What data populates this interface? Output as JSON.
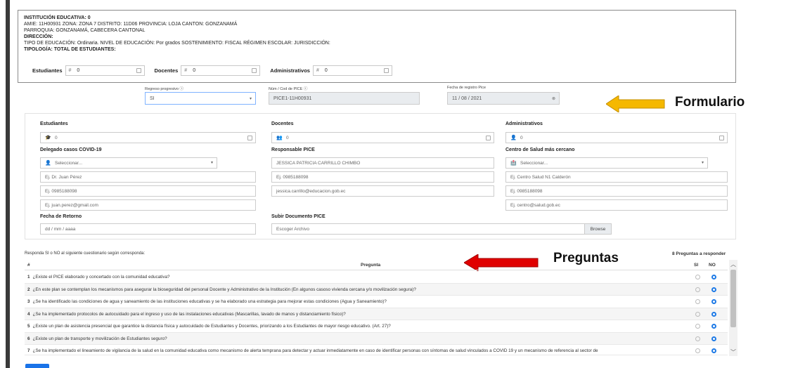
{
  "institution": {
    "line1": "INSTITUCIÓN EDUCATIVA: 0",
    "line2": "AMIE: 11H00931 ZONA: ZONA 7  DISTRITO: 11D06  PROVINCIA: LOJA  CANTON: GONZANAMÁ",
    "line3": "PARROQUIA: GONZANAMÁ, CABECERA CANTONAL",
    "line4": "DIRECCIÓN:",
    "line5": "TIPO DE EDUCACIÓN: Ordinaria.  NIVEL DE EDUCACIÓN: Por grados  SOSTENIMIENTO: FISCAL  RÉGIMEN ESCOLAR:   JURISDICCIÓN:",
    "line6": "TIPOLOGÍA:  TOTAL DE ESTUDIANTES:",
    "counters": [
      {
        "label": "Estudiantes",
        "hash": "#",
        "value": "0"
      },
      {
        "label": "Docentes",
        "hash": "#",
        "value": "0"
      },
      {
        "label": "Administrativos",
        "hash": "#",
        "value": "0"
      }
    ]
  },
  "header_form": {
    "regreso_label": "Regreso progresivo ⓘ",
    "regreso_value": "SI",
    "cod_label": "Núm / Cod de PICE ⓘ",
    "cod_value": "PICE1-11H00931",
    "fecha_label": "Fecha de registro Pice",
    "fecha_value": "11 / 08 / 2021"
  },
  "annotations": {
    "formulario": "Formulario",
    "preguntas": "Preguntas",
    "arrow_yellow_color": "#f5b800",
    "arrow_red_color": "#e00000"
  },
  "form": {
    "estudiantes_label": "Estudiantes",
    "estudiantes_value": "0",
    "docentes_label": "Docentes",
    "docentes_value": "0",
    "admin_label": "Administrativos",
    "admin_value": "0",
    "delegado_label": "Delegado casos COVID-19",
    "delegado_select": "Seleccionar...",
    "delegado_name_ph": "Ej. Dr. Juan Pérez",
    "delegado_phone_ph": "Ej. 0985188098",
    "delegado_email_ph": "Ej. juan.perez@gmail.com",
    "responsable_label": "Responsable PICE",
    "responsable_name": "JESSICA PATRICIA CARRILLO CHIMBO",
    "responsable_phone_ph": "Ej. 0985188098",
    "responsable_email": "jessica.carrillo@educacion.gob.ec",
    "centro_label": "Centro de Salud más cercano",
    "centro_select": "Seleccionar...",
    "centro_name_ph": "Ej. Centro Salud N1 Calderón",
    "centro_phone_ph": "Ej. 0985188098",
    "centro_email_ph": "Ej. centro@salud.gob.ec",
    "retorno_label": "Fecha de Retorno",
    "retorno_ph": "dd / mm / aaaa",
    "doc_label": "Subir Documento PICE",
    "doc_ph": "Escoger Archivo",
    "browse": "Browse"
  },
  "questions": {
    "instruction": "Responda SI o NO al siguiente cuestionario según corresponda:",
    "count": "8 Preguntas a responder",
    "col_num": "#",
    "col_pregunta": "Pregunta",
    "col_si": "SI",
    "col_no": "NO",
    "items": [
      {
        "num": "1",
        "text": "¿Existe el PICE elaborado y concertado con la comunidad educativa?"
      },
      {
        "num": "2",
        "text": "¿En este plan se contemplan los mecanismos para asegurar la bioseguridad del personal Docente y Administrativo de la Institución (En algunos casoso vivienda cercana y/o movilización segura)?"
      },
      {
        "num": "3",
        "text": "¿Se ha identificado las condiciones de agua y saneamiento de las instituciones educativas y se ha elaborado una estrategia para mejorar estas condiciones (Agua y Saneamiento)?"
      },
      {
        "num": "4",
        "text": "¿Se ha implementado protocolos de autocuidado para el ingreso y uso de las instalaciones educativas (Mascarillas, lavado de manos y distanciamiento físico)?"
      },
      {
        "num": "5",
        "text": "¿Existe un plan de asistencia presencial que garantice la distancia física y autocuidado de Estudiantes y Docentes, priorizando a los Estudiantes de mayor riesgo educativo. (Art. 27)?"
      },
      {
        "num": "6",
        "text": "¿Existe un plan de transporte y movilización de Estudiantes seguro?"
      },
      {
        "num": "7",
        "text": "¿Se ha implementado el lineamiento de vigilancia de la salud en la comunidad educativa como mecanismo de alerta temprana para detectar y actuar inmediatamente en caso de identificar personas con síntomas de salud vinculados a COVID 19 y un mecanismo de referencia al sector de"
      }
    ]
  }
}
